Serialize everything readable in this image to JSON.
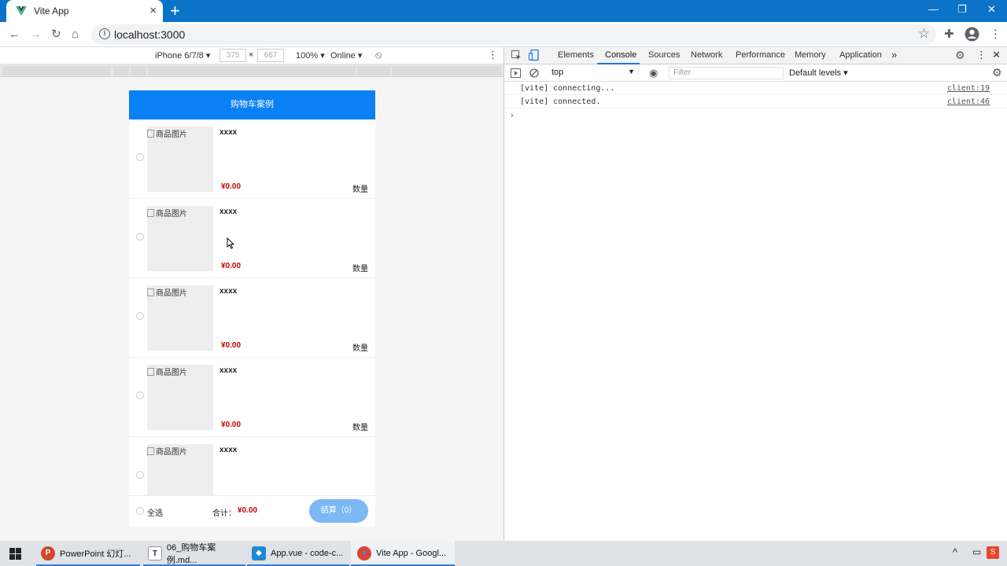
{
  "browser": {
    "tab_title": "Vite App",
    "url": "localhost:3000"
  },
  "device_toolbar": {
    "device": "iPhone 6/7/8",
    "width": "375",
    "times": "×",
    "height": "667",
    "zoom": "100%",
    "network": "Online"
  },
  "app": {
    "header_title": "购物车案例",
    "items": [
      {
        "img_alt": "商品图片",
        "name": "xxxx",
        "price": "¥0.00",
        "qty_label": "数量"
      },
      {
        "img_alt": "商品图片",
        "name": "xxxx",
        "price": "¥0.00",
        "qty_label": "数量"
      },
      {
        "img_alt": "商品图片",
        "name": "xxxx",
        "price": "¥0.00",
        "qty_label": "数量"
      },
      {
        "img_alt": "商品图片",
        "name": "xxxx",
        "price": "¥0.00",
        "qty_label": "数量"
      },
      {
        "img_alt": "商品图片",
        "name": "xxxx"
      }
    ],
    "footer": {
      "select_all": "全选",
      "total_label": "合计：",
      "total_price": "¥0.00",
      "checkout": "结算（0）"
    }
  },
  "devtools": {
    "tabs": [
      "Elements",
      "Console",
      "Sources",
      "Network",
      "Performance",
      "Memory",
      "Application"
    ],
    "more": "»",
    "context": "top",
    "filter_placeholder": "Filter",
    "levels": "Default levels",
    "logs": [
      {
        "msg": "[vite] connecting...",
        "src": "client:19"
      },
      {
        "msg": "[vite] connected.",
        "src": "client:46"
      }
    ],
    "prompt": "›"
  },
  "taskbar": {
    "tasks": [
      {
        "icon": "P",
        "label": "PowerPoint 幻灯..."
      },
      {
        "icon": "T",
        "label": "06_购物车案例.md..."
      },
      {
        "icon": "◆",
        "label": "App.vue - code-c..."
      },
      {
        "icon": "●",
        "label": "Vite App - Googl..."
      }
    ]
  },
  "colors": {
    "chrome_accent": "#0a73c8",
    "app_header": "#0a80f5",
    "price_red": "#cc0000",
    "checkout_button": "#7db8f5"
  },
  "icons": [
    "vue-logo-icon",
    "close-icon",
    "plus-icon",
    "back-icon",
    "forward-icon",
    "reload-icon",
    "home-icon",
    "info-icon",
    "star-icon",
    "puzzle-icon",
    "account-icon",
    "more-icon",
    "rotate-icon",
    "inspect-icon",
    "device-icon",
    "gear-icon",
    "eye-icon",
    "clear-icon",
    "windows-icon"
  ]
}
